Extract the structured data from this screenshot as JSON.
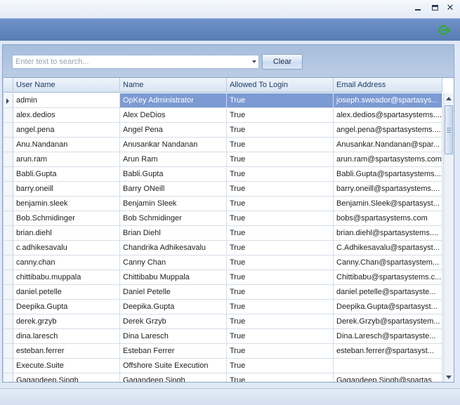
{
  "window": {
    "minimize_icon": "minimize-icon",
    "maximize_icon": "maximize-icon",
    "close_glyph": "✕"
  },
  "header": {
    "logout_icon": "logout-icon",
    "accent_color": "#5f82bc"
  },
  "search": {
    "placeholder": "Enter text to search...",
    "value": "",
    "clear_label": "Clear"
  },
  "grid": {
    "columns": [
      "User Name",
      "Name",
      "Allowed To Login",
      "Email Address"
    ],
    "selected_row": 0,
    "selected_color": "#7c9ad3",
    "rows": [
      {
        "user": "admin",
        "name": "OpKey Administrator",
        "allowed": "True",
        "email": "joseph.sweador@spartasys..."
      },
      {
        "user": "alex.dedios",
        "name": "Alex DeDios",
        "allowed": "True",
        "email": "alex.dedios@spartasystems...."
      },
      {
        "user": "angel.pena",
        "name": "Angel Pena",
        "allowed": "True",
        "email": "angel.pena@spartasystems...."
      },
      {
        "user": "Anu.Nandanan",
        "name": "Anusankar Nandanan",
        "allowed": "True",
        "email": "Anusankar.Nandanan@spar..."
      },
      {
        "user": "arun.ram",
        "name": "Arun Ram",
        "allowed": "True",
        "email": "arun.ram@spartasystems.com"
      },
      {
        "user": "Babli.Gupta",
        "name": "Babli.Gupta",
        "allowed": "True",
        "email": "Babli.Gupta@spartasystems...."
      },
      {
        "user": "barry.oneill",
        "name": "Barry ONeill",
        "allowed": "True",
        "email": "barry.oneill@spartasystems...."
      },
      {
        "user": "benjamin.sleek",
        "name": "Benjamin Sleek",
        "allowed": "True",
        "email": "Benjamin.Sleek@spartasyst..."
      },
      {
        "user": "Bob.Schmidinger",
        "name": "Bob Schmidinger",
        "allowed": "True",
        "email": "bobs@spartasystems.com"
      },
      {
        "user": "brian.diehl",
        "name": "Brian Diehl",
        "allowed": "True",
        "email": "brian.diehl@spartasystems...."
      },
      {
        "user": "c.adhikesavalu",
        "name": "Chandrika Adhikesavalu",
        "allowed": "True",
        "email": "C.Adhikesavalu@spartasyst..."
      },
      {
        "user": "canny.chan",
        "name": "Canny Chan",
        "allowed": "True",
        "email": "Canny.Chan@spartasystem..."
      },
      {
        "user": "chittibabu.muppala",
        "name": "Chittibabu Muppala",
        "allowed": "True",
        "email": "Chittibabu@spartasystems.c..."
      },
      {
        "user": "daniel.petelle",
        "name": "Daniel Petelle",
        "allowed": "True",
        "email": "daniel.petelle@spartasyste..."
      },
      {
        "user": "Deepika.Gupta",
        "name": "Deepika.Gupta",
        "allowed": "True",
        "email": "Deepika.Gupta@spartasyst..."
      },
      {
        "user": "derek.grzyb",
        "name": "Derek Grzyb",
        "allowed": "True",
        "email": "Derek.Grzyb@spartasystem..."
      },
      {
        "user": "dina.laresch",
        "name": "Dina Laresch",
        "allowed": "True",
        "email": "Dina.Laresch@spartasyste..."
      },
      {
        "user": "esteban.ferrer",
        "name": "Esteban Ferrer",
        "allowed": "True",
        "email": "esteban.ferrer@spartasyst..."
      },
      {
        "user": "Execute.Suite",
        "name": "Offshore Suite Execution",
        "allowed": "True",
        "email": ""
      },
      {
        "user": "Gagandeep.Singh",
        "name": "Gagandeep Singh",
        "allowed": "True",
        "email": "Gagandeep.Singh@spartas..."
      }
    ]
  }
}
